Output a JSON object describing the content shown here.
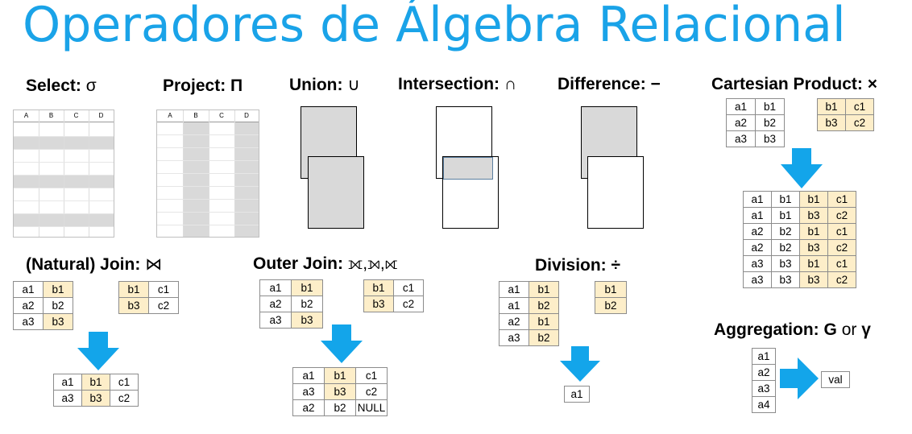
{
  "title": "Operadores de Álgebra Relacional",
  "colors": {
    "title": "#1aa3e8",
    "arrow": "#13a5ea",
    "highlight": "#fdeec9",
    "band": "#d9d9d9"
  },
  "select": {
    "label": "Select:",
    "symbol": "σ",
    "columns": [
      "A",
      "B",
      "C",
      "D"
    ]
  },
  "project": {
    "label": "Project:",
    "symbol": "Π",
    "columns": [
      "A",
      "B",
      "C",
      "D"
    ]
  },
  "union": {
    "label": "Union:",
    "symbol": "∪"
  },
  "intersection": {
    "label": "Intersection:",
    "symbol": "∩"
  },
  "difference": {
    "label": "Difference:",
    "symbol": "−"
  },
  "cartesian": {
    "label": "Cartesian Product:",
    "symbol": "×",
    "r": [
      [
        "a1",
        "b1"
      ],
      [
        "a2",
        "b2"
      ],
      [
        "a3",
        "b3"
      ]
    ],
    "s": [
      [
        "b1",
        "c1"
      ],
      [
        "b3",
        "c2"
      ]
    ],
    "result": [
      [
        "a1",
        "b1",
        "b1",
        "c1"
      ],
      [
        "a1",
        "b1",
        "b3",
        "c2"
      ],
      [
        "a2",
        "b2",
        "b1",
        "c1"
      ],
      [
        "a2",
        "b2",
        "b3",
        "c2"
      ],
      [
        "a3",
        "b3",
        "b1",
        "c1"
      ],
      [
        "a3",
        "b3",
        "b3",
        "c2"
      ]
    ]
  },
  "join": {
    "label": "(Natural) Join:",
    "symbol": "⋈",
    "r": [
      [
        "a1",
        "b1"
      ],
      [
        "a2",
        "b2"
      ],
      [
        "a3",
        "b3"
      ]
    ],
    "s": [
      [
        "b1",
        "c1"
      ],
      [
        "b3",
        "c2"
      ]
    ],
    "result": [
      [
        "a1",
        "b1",
        "c1"
      ],
      [
        "a3",
        "b3",
        "c2"
      ]
    ]
  },
  "outer_join": {
    "label": "Outer Join:",
    "symbol": "⟗,⟕,⟖",
    "r": [
      [
        "a1",
        "b1"
      ],
      [
        "a2",
        "b2"
      ],
      [
        "a3",
        "b3"
      ]
    ],
    "s": [
      [
        "b1",
        "c1"
      ],
      [
        "b3",
        "c2"
      ]
    ],
    "result": [
      [
        "a1",
        "b1",
        "c1"
      ],
      [
        "a3",
        "b3",
        "c2"
      ],
      [
        "a2",
        "b2",
        "NULL"
      ]
    ]
  },
  "division": {
    "label": "Division:",
    "symbol": "÷",
    "r": [
      [
        "a1",
        "b1"
      ],
      [
        "a1",
        "b2"
      ],
      [
        "a2",
        "b1"
      ],
      [
        "a3",
        "b2"
      ]
    ],
    "s": [
      [
        "b1"
      ],
      [
        "b2"
      ]
    ],
    "result": [
      [
        "a1"
      ]
    ]
  },
  "aggregation": {
    "label": "Aggregation:",
    "symbol_g": "G",
    "or_text": "or",
    "symbol_gamma": "γ",
    "input": [
      [
        "a1"
      ],
      [
        "a2"
      ],
      [
        "a3"
      ],
      [
        "a4"
      ]
    ],
    "result": "val"
  }
}
